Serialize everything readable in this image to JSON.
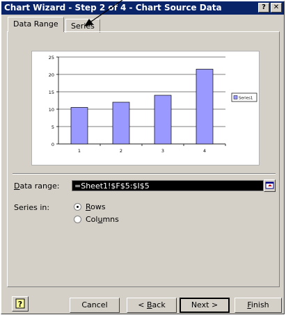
{
  "window": {
    "title": "Chart Wizard - Step 2 of 4 - Chart Source Data",
    "help_glyph": "?",
    "close_glyph": "✕"
  },
  "tabs": [
    {
      "label": "Data Range",
      "active": true
    },
    {
      "label": "Series",
      "active": false
    }
  ],
  "chart_data": {
    "type": "bar",
    "categories": [
      "1",
      "2",
      "3",
      "4"
    ],
    "series": [
      {
        "name": "Series1",
        "values": [
          10.5,
          12,
          14,
          21.5
        ],
        "color": "#9999ff"
      }
    ],
    "y_ticks": [
      "0",
      "5",
      "10",
      "15",
      "20",
      "25"
    ],
    "ylim": [
      0,
      25
    ],
    "grid": true,
    "legend": "right",
    "title": "",
    "xlabel": "",
    "ylabel": ""
  },
  "form": {
    "data_range_label": "Data range:",
    "data_range_value": "=Sheet1!$F$5:$I$5",
    "series_in_label": "Series in:",
    "options": [
      {
        "label": "Rows",
        "selected": true
      },
      {
        "label": "Columns",
        "selected": false
      }
    ]
  },
  "buttons": {
    "cancel": "Cancel",
    "back": "< Back",
    "next": "Next >",
    "finish": "Finish"
  },
  "colors": {
    "title_bar": "#0a246a",
    "dialog_face": "#d4d0c8",
    "bar_fill": "#9999ff"
  }
}
